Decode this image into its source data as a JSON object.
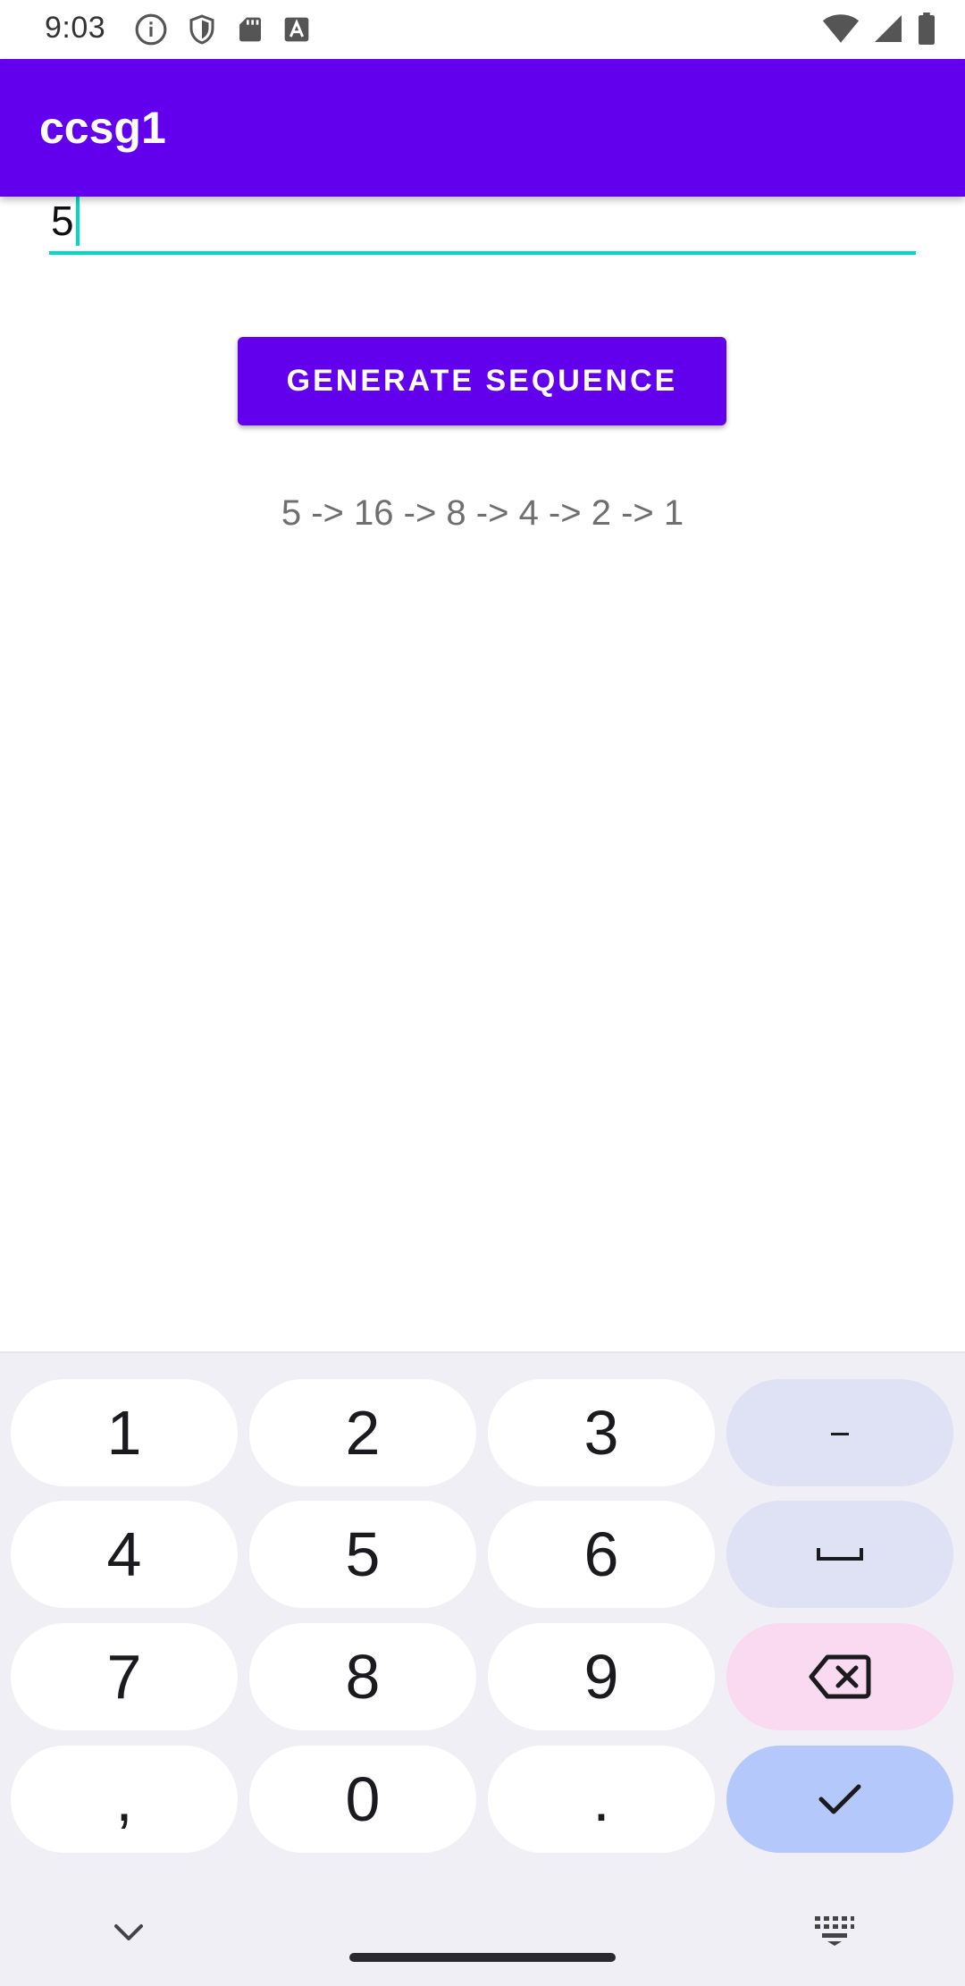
{
  "status_bar": {
    "time": "9:03",
    "left_icons": [
      "info-icon",
      "shield-icon",
      "sd-card-icon",
      "font-a-icon"
    ],
    "right_icons": [
      "wifi-icon",
      "signal-icon",
      "battery-icon"
    ]
  },
  "app_bar": {
    "title": "ccsg1"
  },
  "input": {
    "value": "5"
  },
  "button": {
    "label": "GENERATE SEQUENCE"
  },
  "result": {
    "text": "5 -> 16 -> 8 -> 4 -> 2 -> 1"
  },
  "keyboard": {
    "keys": {
      "k1": "1",
      "k2": "2",
      "k3": "3",
      "k4": "4",
      "k5": "5",
      "k6": "6",
      "k7": "7",
      "k8": "8",
      "k9": "9",
      "comma": ",",
      "k0": "0",
      "period": "."
    },
    "function_icons": [
      "minus-icon",
      "space-icon",
      "backspace-icon",
      "check-icon",
      "chevron-down-icon",
      "keyboard-icon"
    ]
  },
  "colors": {
    "primary": "#6200ee",
    "accent": "#03dac5",
    "key_fn": "#dfe1f4",
    "key_delete": "#fadaf0",
    "key_done": "#b5c8fb",
    "keyboard_bg": "#f0eff6"
  }
}
